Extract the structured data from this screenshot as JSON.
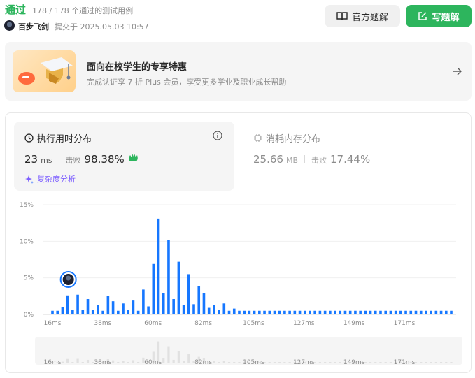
{
  "header": {
    "status": "通过",
    "passed_text": "178 / 178 个通过的测试用例",
    "user": "百步飞剑",
    "submit_time": "提交于 2025.05.03 10:57",
    "official_button": "官方题解",
    "write_button": "写题解"
  },
  "promo": {
    "title": "面向在校学生的专享特惠",
    "subtitle": "完成认证享 7 折 Plus 会员，享受更多学业及职业成长帮助"
  },
  "runtime": {
    "title": "执行用时分布",
    "value": "23",
    "unit": "ms",
    "beat_label": "击败",
    "beat_value": "98.38%",
    "complexity_link": "复杂度分析"
  },
  "memory": {
    "title": "消耗内存分布",
    "value": "25.66",
    "unit": "MB",
    "beat_label": "击败",
    "beat_value": "17.44%"
  },
  "colors": {
    "accent_green": "#2db55d",
    "bar_blue": "#1677ff",
    "purple": "#7d5fff"
  },
  "chart_data": {
    "type": "bar",
    "ylabel": "",
    "xlabel": "",
    "y_ticks": [
      "15%",
      "10%",
      "5%",
      "0%"
    ],
    "ylim": [
      0,
      15
    ],
    "x_ticks": [
      "16ms",
      "38ms",
      "60ms",
      "82ms",
      "105ms",
      "127ms",
      "149ms",
      "171ms"
    ],
    "values": [
      0.5,
      0.5,
      1.0,
      2.6,
      0.6,
      2.7,
      0.6,
      2.1,
      0.6,
      1.3,
      0.5,
      2.5,
      1.8,
      0.5,
      1.5,
      0.6,
      1.9,
      0.5,
      3.4,
      1.1,
      6.9,
      13.1,
      2.9,
      10.2,
      2.1,
      7.2,
      1.3,
      5.5,
      1.4,
      3.9,
      2.9,
      0.9,
      1.3,
      0.6,
      1.5,
      0.5,
      0.8,
      0.5,
      0.5,
      0.5,
      0.5,
      0.5,
      0.5,
      0.5,
      0.5,
      0.5,
      0.5,
      0.5,
      0.5,
      0.5,
      0.5,
      0.5,
      0.5,
      0.5,
      0.5,
      0.5,
      0.5,
      0.5,
      0.5,
      0.5,
      0.5,
      0.5,
      0.5,
      0.5,
      0.5,
      0.5,
      0.5,
      0.5,
      0.5,
      0.5,
      0.5,
      0.5,
      0.5,
      0.5,
      0.5,
      0.5,
      0.5,
      0.5,
      0.5,
      0.5
    ],
    "user_bar_index": 3,
    "grid": true,
    "brush_labels": [
      "16ms",
      "38ms",
      "60ms",
      "82ms",
      "105ms",
      "127ms",
      "149ms",
      "171ms"
    ]
  }
}
